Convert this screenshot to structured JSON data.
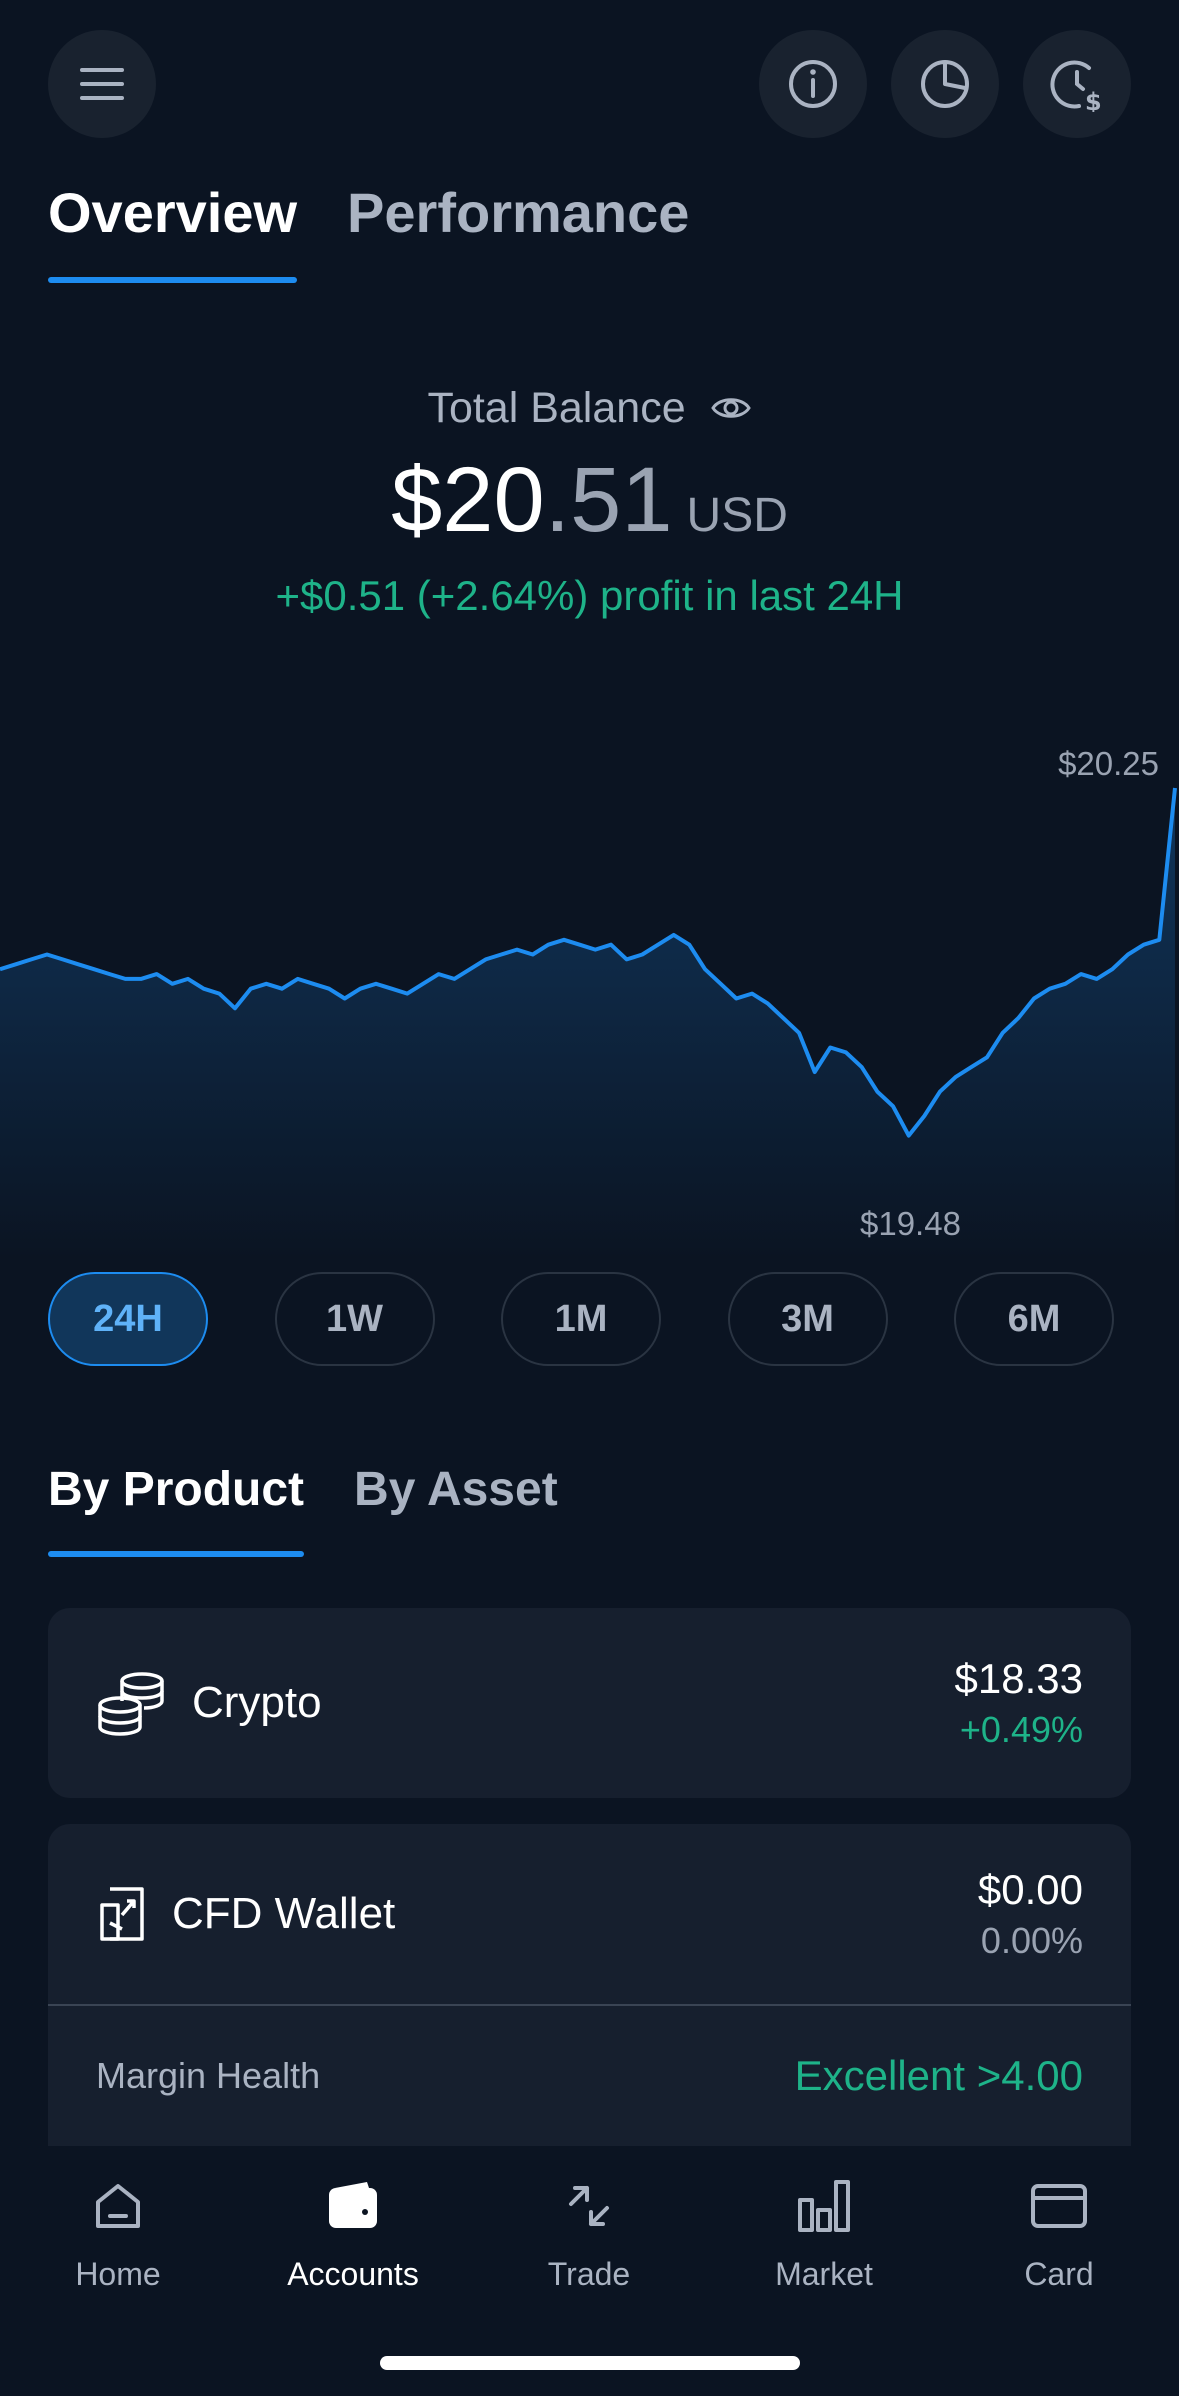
{
  "header": {
    "menu_icon": "menu-icon",
    "actions": [
      "info-icon",
      "pie-chart-icon",
      "clock-dollar-icon"
    ]
  },
  "tabs": [
    {
      "label": "Overview",
      "active": true
    },
    {
      "label": "Performance",
      "active": false
    }
  ],
  "balance": {
    "label": "Total Balance",
    "whole": "$20",
    "cents": ".51",
    "currency": "USD",
    "profit": "+$0.51 (+2.64%) profit in last 24H"
  },
  "chart_data": {
    "type": "area",
    "high_label": "$20.25",
    "low_label": "$19.48",
    "ylim": [
      19.48,
      20.25
    ],
    "values": [
      19.88,
      19.89,
      19.9,
      19.91,
      19.9,
      19.89,
      19.88,
      19.87,
      19.86,
      19.86,
      19.87,
      19.85,
      19.86,
      19.84,
      19.83,
      19.8,
      19.84,
      19.85,
      19.84,
      19.86,
      19.85,
      19.84,
      19.82,
      19.84,
      19.85,
      19.84,
      19.83,
      19.85,
      19.87,
      19.86,
      19.88,
      19.9,
      19.91,
      19.92,
      19.91,
      19.93,
      19.94,
      19.93,
      19.92,
      19.93,
      19.9,
      19.91,
      19.93,
      19.95,
      19.93,
      19.88,
      19.85,
      19.82,
      19.83,
      19.81,
      19.78,
      19.75,
      19.67,
      19.72,
      19.71,
      19.68,
      19.63,
      19.6,
      19.54,
      19.58,
      19.63,
      19.66,
      19.68,
      19.7,
      19.75,
      19.78,
      19.82,
      19.84,
      19.85,
      19.87,
      19.86,
      19.88,
      19.91,
      19.93,
      19.94,
      20.25
    ]
  },
  "ranges": [
    {
      "label": "24H",
      "active": true
    },
    {
      "label": "1W",
      "active": false
    },
    {
      "label": "1M",
      "active": false
    },
    {
      "label": "3M",
      "active": false
    },
    {
      "label": "6M",
      "active": false
    }
  ],
  "product_tabs": [
    {
      "label": "By Product",
      "active": true
    },
    {
      "label": "By Asset",
      "active": false
    }
  ],
  "products": {
    "crypto": {
      "name": "Crypto",
      "value": "$18.33",
      "change": "+0.49%",
      "icon": "coins-icon"
    },
    "cfd": {
      "name": "CFD Wallet",
      "value": "$0.00",
      "change": "0.00%",
      "icon": "cfd-wallet-icon"
    },
    "margin": {
      "label": "Margin Health",
      "value": "Excellent >4.00"
    }
  },
  "nav": [
    {
      "label": "Home",
      "icon": "home-icon",
      "active": false
    },
    {
      "label": "Accounts",
      "icon": "wallet-icon",
      "active": true
    },
    {
      "label": "Trade",
      "icon": "trade-arrows-icon",
      "active": false
    },
    {
      "label": "Market",
      "icon": "bar-chart-icon",
      "active": false
    },
    {
      "label": "Card",
      "icon": "card-icon",
      "active": false
    }
  ],
  "colors": {
    "background": "#0b1422",
    "accent": "#1d8cf0",
    "positive": "#1eb389"
  }
}
